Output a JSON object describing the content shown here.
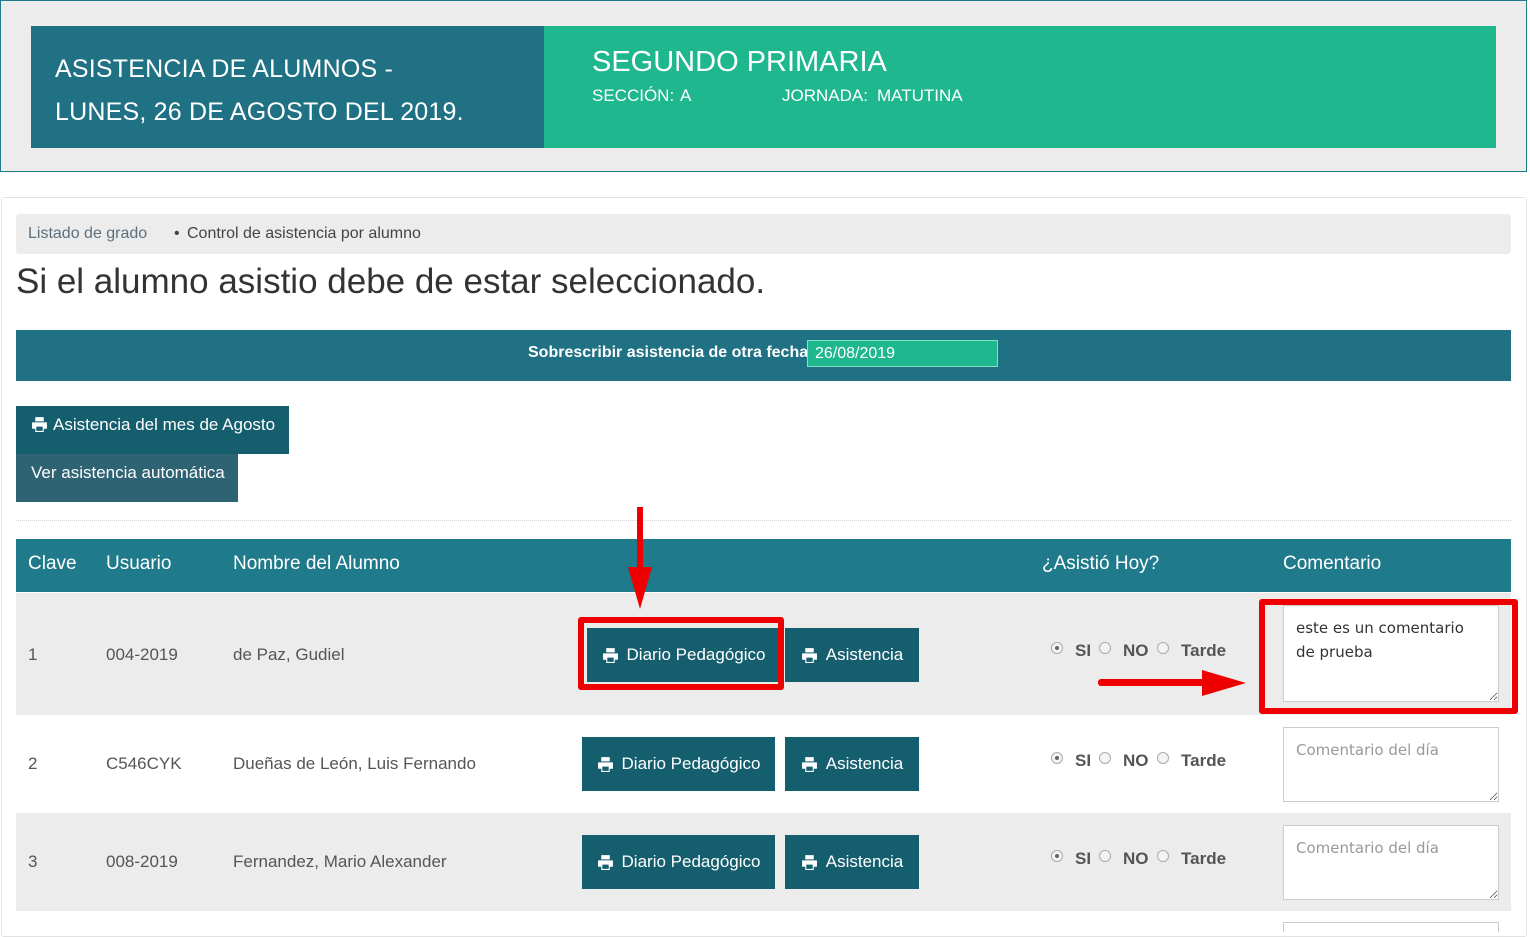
{
  "header": {
    "title_line1": "ASISTENCIA DE ALUMNOS -",
    "title_line2": "LUNES, 26 DE AGOSTO DEL 2019.",
    "grade": "SEGUNDO PRIMARIA",
    "section_label": "SECCIÓN:",
    "section_value": "A",
    "shift_label": "JORNADA:",
    "shift_value": "MATUTINA"
  },
  "breadcrumb": {
    "link": "Listado de grado",
    "separator": "•",
    "current": "Control de asistencia por alumno"
  },
  "page_heading": "Si el alumno asistio debe de estar seleccionado.",
  "date_override": {
    "label": "Sobrescribir asistencia de otra fecha.",
    "value": "26/08/2019"
  },
  "actions": {
    "month_attendance": "Asistencia del mes de Agosto",
    "auto_attendance": "Ver asistencia automática"
  },
  "table": {
    "headers": {
      "clave": "Clave",
      "usuario": "Usuario",
      "nombre": "Nombre del Alumno",
      "asistio": "¿Asistió Hoy?",
      "comentario": "Comentario"
    },
    "diary_label": "Diario Pedagógico",
    "attendance_label": "Asistencia",
    "radio_labels": {
      "yes": "SI",
      "no": "NO",
      "late": "Tarde"
    },
    "comment_placeholder": "Comentario del día",
    "rows": [
      {
        "clave": "1",
        "usuario": "004-2019",
        "nombre": "de Paz, Gudiel",
        "asistio": "SI",
        "comentario": "este es un comentario de prueba"
      },
      {
        "clave": "2",
        "usuario": "C546CYK",
        "nombre": "Dueñas de León, Luis Fernando",
        "asistio": "SI",
        "comentario": ""
      },
      {
        "clave": "3",
        "usuario": "008-2019",
        "nombre": "Fernandez, Mario Alexander",
        "asistio": "SI",
        "comentario": ""
      }
    ]
  },
  "colors": {
    "header_dark": "#1f7183",
    "header_green": "#1eb78e",
    "button": "#155e6e",
    "annotation_red": "#ee0000"
  },
  "icons": [
    "print-icon",
    "arrow-down-annotation",
    "arrow-right-annotation"
  ]
}
